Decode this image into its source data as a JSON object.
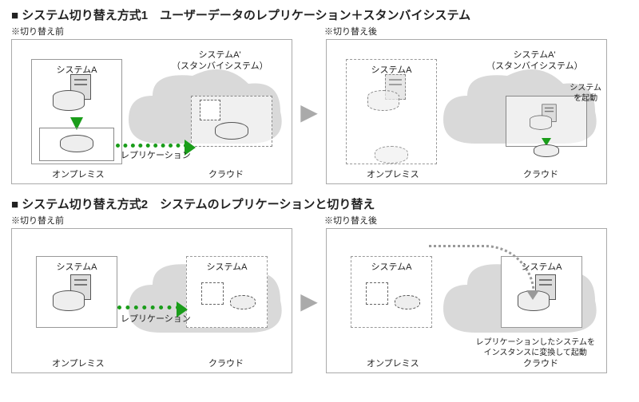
{
  "method1": {
    "title": "■ システム切り替え方式1　ユーザーデータのレプリケーション＋スタンバイシステム",
    "before": {
      "note": "※切り替え前",
      "systemA": "システムA",
      "systemAprime": "システムA'\n（スタンバイシステム）",
      "replication": "レプリケーション",
      "onprem": "オンプレミス",
      "cloud": "クラウド"
    },
    "after": {
      "note": "※切り替え後",
      "systemA": "システムA",
      "systemAprime": "システムA'\n（スタンバイシステム）",
      "startSystem": "システム\nを起動",
      "onprem": "オンプレミス",
      "cloud": "クラウド"
    }
  },
  "method2": {
    "title": "■ システム切り替え方式2　システムのレプリケーションと切り替え",
    "before": {
      "note": "※切り替え前",
      "systemA": "システムA",
      "systemAcloud": "システムA",
      "replication": "レプリケーション",
      "onprem": "オンプレミス",
      "cloud": "クラウド"
    },
    "after": {
      "note": "※切り替え後",
      "systemA": "システムA",
      "systemAcloud": "システムA",
      "convert": "レプリケーションしたシステムを\nインスタンスに変換して起動",
      "onprem": "オンプレミス",
      "cloud": "クラウド"
    }
  }
}
